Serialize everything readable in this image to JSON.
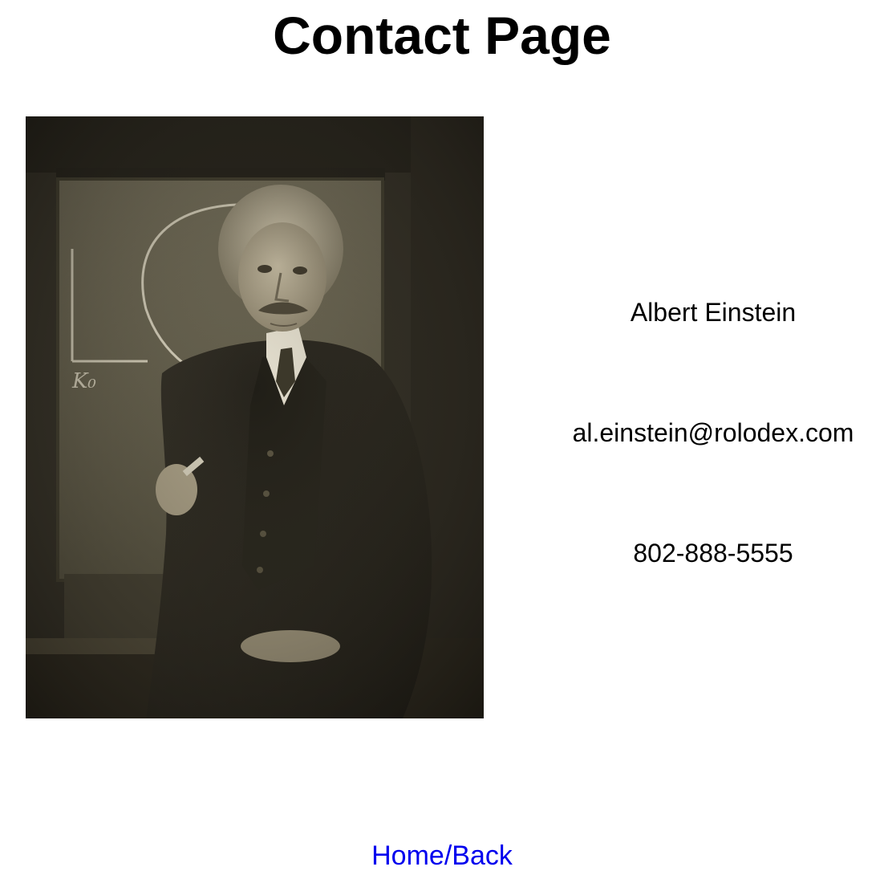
{
  "page": {
    "title": "Contact Page"
  },
  "contact": {
    "photo_alt": "Albert Einstein",
    "name": "Albert Einstein",
    "email": "al.einstein@rolodex.com",
    "phone": "802-888-5555"
  },
  "nav": {
    "home_link_label": "Home/Back"
  },
  "colors": {
    "link": "#0000ee",
    "text": "#000000",
    "background": "#ffffff"
  }
}
